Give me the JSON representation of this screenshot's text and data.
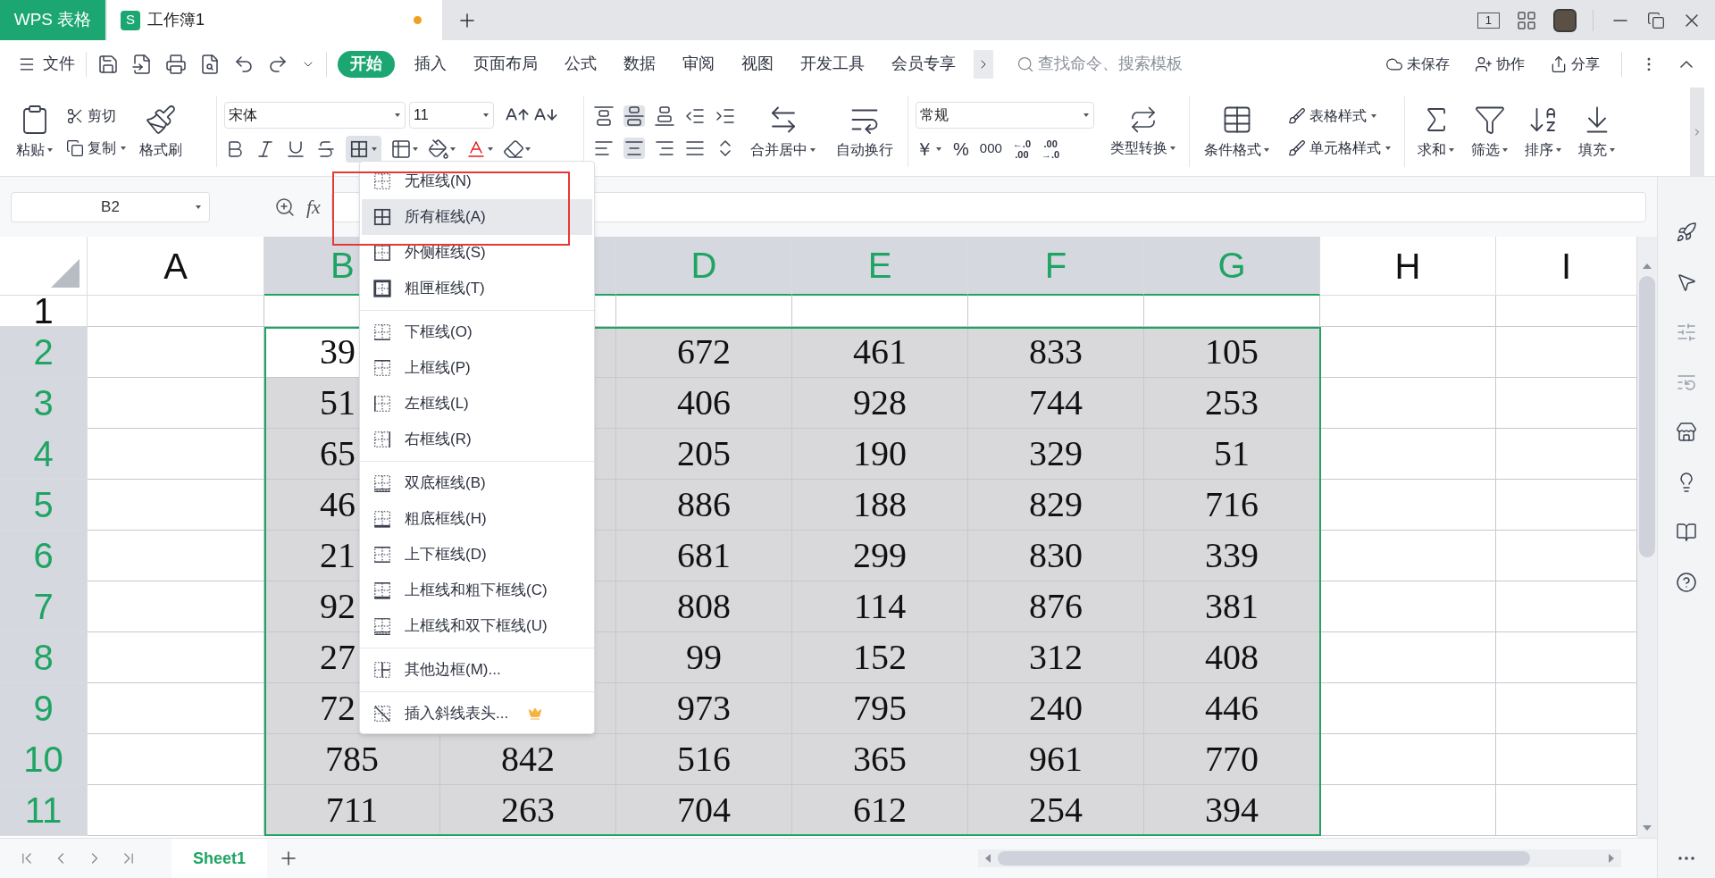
{
  "title_bar": {
    "app_tab": "WPS 表格",
    "doc_tab": {
      "badge": "S",
      "title": "工作簿1",
      "unsaved": true
    },
    "screen_badge": "1"
  },
  "menu_bar": {
    "file": "文件",
    "tabs": [
      {
        "label": "开始",
        "selected": true
      },
      {
        "label": "插入",
        "selected": false
      },
      {
        "label": "页面布局",
        "selected": false
      },
      {
        "label": "公式",
        "selected": false
      },
      {
        "label": "数据",
        "selected": false
      },
      {
        "label": "审阅",
        "selected": false
      },
      {
        "label": "视图",
        "selected": false
      },
      {
        "label": "开发工具",
        "selected": false
      },
      {
        "label": "会员专享",
        "selected": false
      }
    ],
    "search": {
      "placeholder": "查找命令、搜索模板"
    },
    "save_status": "未保存",
    "collaborate": "协作",
    "share": "分享"
  },
  "ribbon": {
    "clipboard": {
      "paste": "粘贴",
      "cut": "剪切",
      "copy": "复制",
      "format_painter": "格式刷"
    },
    "font": {
      "name": "宋体",
      "size": "11",
      "border_menu_open": true
    },
    "alignment": {
      "merge": "合并居中",
      "wrap": "自动换行"
    },
    "number": {
      "format": "常规",
      "currency": "￥",
      "percent": "%",
      "thousands": "000",
      "increase_decimal": {
        "top": "←.0",
        "bottom": ".00"
      },
      "decrease_decimal": {
        "top": ".00",
        "bottom": "→.0"
      },
      "convert": "类型转换"
    },
    "styles": {
      "conditional": "条件格式",
      "table_style": "表格样式",
      "cell_style": "单元格样式"
    },
    "editing": [
      "求和",
      "筛选",
      "排序",
      "填充"
    ]
  },
  "formula_bar": {
    "name_box": "B2",
    "function_label": "fx"
  },
  "sheet": {
    "columns": [
      {
        "label": "A",
        "selected": false
      },
      {
        "label": "B",
        "selected": true
      },
      {
        "selected": true
      },
      {
        "label": "D",
        "selected": true
      },
      {
        "label": "E",
        "selected": true
      },
      {
        "label": "F",
        "selected": true
      },
      {
        "label": "G",
        "selected": true
      },
      {
        "label": "H",
        "selected": false
      },
      {
        "label": "I",
        "selected": false
      }
    ],
    "rows": [
      {
        "number": "1",
        "selected": false,
        "cells": []
      },
      {
        "number": "2",
        "selected": true,
        "cells": [
          {},
          {
            "text": "39",
            "active": true
          },
          {},
          {
            "text": "672"
          },
          {
            "text": "461"
          },
          {
            "text": "833"
          },
          {
            "text": "105"
          }
        ]
      },
      {
        "number": "3",
        "selected": true,
        "cells": [
          {},
          {
            "text": "51"
          },
          {},
          {
            "text": "406"
          },
          {
            "text": "928"
          },
          {
            "text": "744"
          },
          {
            "text": "253"
          }
        ]
      },
      {
        "number": "4",
        "selected": true,
        "cells": [
          {},
          {
            "text": "65"
          },
          {},
          {
            "text": "205"
          },
          {
            "text": "190"
          },
          {
            "text": "329"
          },
          {
            "text": "51"
          }
        ]
      },
      {
        "number": "5",
        "selected": true,
        "cells": [
          {},
          {
            "text": "46"
          },
          {},
          {
            "text": "886"
          },
          {
            "text": "188"
          },
          {
            "text": "829"
          },
          {
            "text": "716"
          }
        ]
      },
      {
        "number": "6",
        "selected": true,
        "cells": [
          {},
          {
            "text": "21"
          },
          {},
          {
            "text": "681"
          },
          {
            "text": "299"
          },
          {
            "text": "830"
          },
          {
            "text": "339"
          }
        ]
      },
      {
        "number": "7",
        "selected": true,
        "cells": [
          {},
          {
            "text": "92"
          },
          {},
          {
            "text": "808"
          },
          {
            "text": "114"
          },
          {
            "text": "876"
          },
          {
            "text": "381"
          }
        ]
      },
      {
        "number": "8",
        "selected": true,
        "cells": [
          {},
          {
            "text": "27"
          },
          {},
          {
            "text": "99"
          },
          {
            "text": "152"
          },
          {
            "text": "312"
          },
          {
            "text": "408"
          }
        ]
      },
      {
        "number": "9",
        "selected": true,
        "cells": [
          {},
          {
            "text": "72"
          },
          {},
          {
            "text": "973"
          },
          {
            "text": "795"
          },
          {
            "text": "240"
          },
          {
            "text": "446"
          }
        ]
      },
      {
        "number": "10",
        "selected": true,
        "cells": [
          {},
          {
            "text": "785"
          },
          {
            "text": "842"
          },
          {
            "text": "516"
          },
          {
            "text": "365"
          },
          {
            "text": "961"
          },
          {
            "text": "770"
          }
        ]
      },
      {
        "number": "11",
        "selected": true,
        "cells": [
          {},
          {
            "text": "711"
          },
          {
            "text": "263"
          },
          {
            "text": "704"
          },
          {
            "text": "612"
          },
          {
            "text": "254"
          },
          {
            "text": "394"
          }
        ]
      }
    ]
  },
  "border_menu": {
    "groups": [
      [
        {
          "label": "无框线(N)",
          "selected": false,
          "premium": false
        },
        {
          "label": "所有框线(A)",
          "selected": true,
          "premium": false
        },
        {
          "label": "外侧框线(S)",
          "selected": false,
          "premium": false
        },
        {
          "label": "粗匣框线(T)",
          "selected": false,
          "premium": false
        }
      ],
      [
        {
          "label": "下框线(O)",
          "selected": false,
          "premium": false
        },
        {
          "label": "上框线(P)",
          "selected": false,
          "premium": false
        },
        {
          "label": "左框线(L)",
          "selected": false,
          "premium": false
        },
        {
          "label": "右框线(R)",
          "selected": false,
          "premium": false
        }
      ],
      [
        {
          "label": "双底框线(B)",
          "selected": false,
          "premium": false
        },
        {
          "label": "粗底框线(H)",
          "selected": false,
          "premium": false
        },
        {
          "label": "上下框线(D)",
          "selected": false,
          "premium": false
        },
        {
          "label": "上框线和粗下框线(C)",
          "selected": false,
          "premium": false
        },
        {
          "label": "上框线和双下框线(U)",
          "selected": false,
          "premium": false
        }
      ],
      [
        {
          "label": "其他边框(M)...",
          "selected": false,
          "premium": false
        }
      ],
      [
        {
          "label": "插入斜线表头...",
          "selected": false,
          "premium": true
        }
      ]
    ]
  },
  "sheet_tabs": [
    {
      "label": "Sheet1",
      "selected": true
    }
  ]
}
